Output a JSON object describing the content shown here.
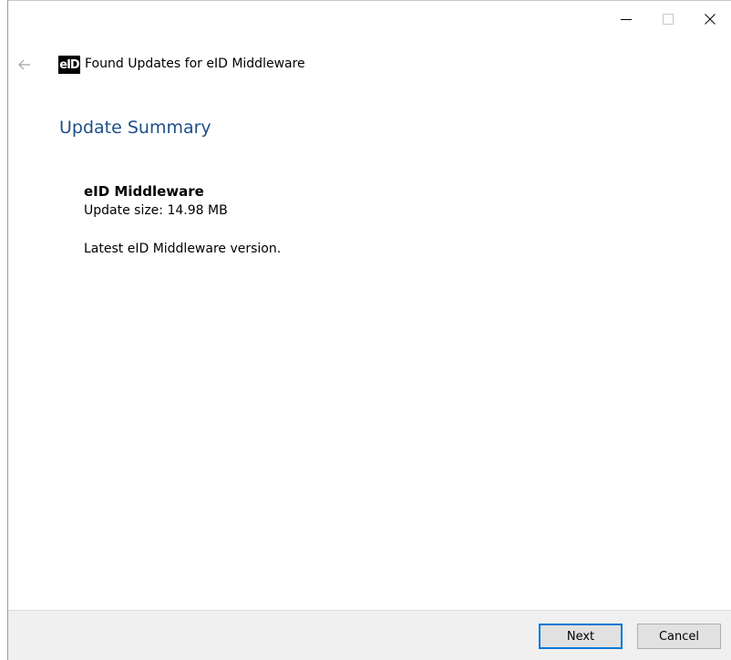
{
  "window": {
    "title": "Found Updates for eID Middleware",
    "logo_text_e": "e",
    "logo_text_id": "ID",
    "controls": {
      "minimize_icon": "minimize-icon",
      "maximize_icon": "maximize-icon",
      "close_icon": "close-icon"
    }
  },
  "nav": {
    "back_icon": "back-arrow-icon"
  },
  "page": {
    "title": "Update Summary"
  },
  "update": {
    "name": "eID Middleware",
    "size": "Update size: 14.98 MB",
    "description": "Latest eID Middleware version."
  },
  "footer": {
    "next_label": "Next",
    "cancel_label": "Cancel"
  },
  "colors": {
    "accent": "#0078d7",
    "title_blue": "#1e4f8a",
    "footer_bg": "#f0f0f0"
  }
}
